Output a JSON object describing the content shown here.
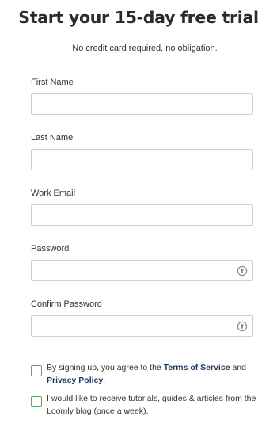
{
  "header": {
    "title": "Start your 15-day free trial",
    "subtitle": "No credit card required, no obligation."
  },
  "form": {
    "first_name": {
      "label": "First Name",
      "value": ""
    },
    "last_name": {
      "label": "Last Name",
      "value": ""
    },
    "work_email": {
      "label": "Work Email",
      "value": ""
    },
    "password": {
      "label": "Password",
      "value": "",
      "icon": "password-reveal-icon"
    },
    "confirm_password": {
      "label": "Confirm Password",
      "value": "",
      "icon": "password-reveal-icon"
    }
  },
  "consent": {
    "terms_prefix": "By signing up, you agree to the ",
    "terms_link": "Terms of Service",
    "terms_middle": " and ",
    "privacy_link": "Privacy Policy",
    "terms_suffix": ".",
    "newsletter": "I would like to receive tutorials, guides & articles from the Loomly blog (once a week)."
  },
  "colors": {
    "checkbox_border": "#5aa96b",
    "link": "#1f3a5f",
    "input_border": "#cfcfcf"
  }
}
